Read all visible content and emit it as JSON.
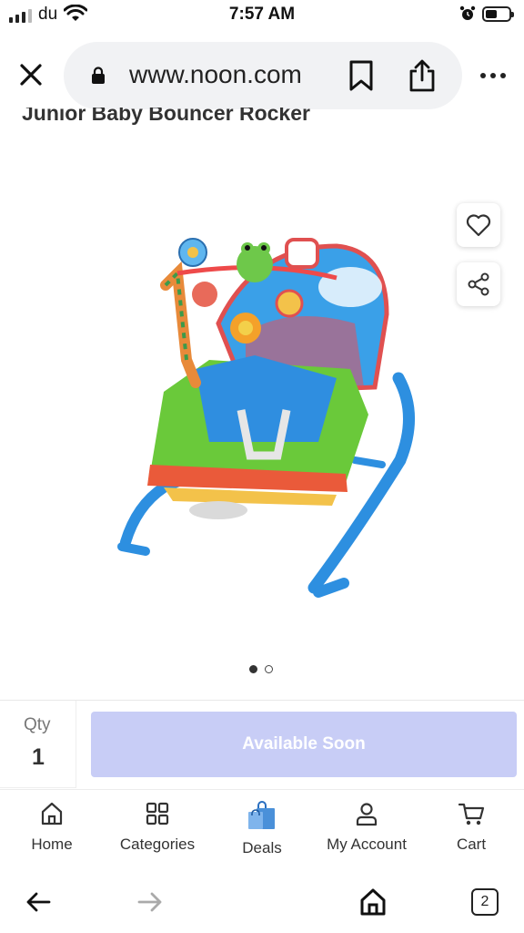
{
  "status_bar": {
    "carrier": "du",
    "time": "7:57 AM",
    "battery_level": 0.5
  },
  "browser": {
    "url": "www.noon.com",
    "icons": [
      "close-icon",
      "lock-icon",
      "bookmark-icon",
      "share-icon",
      "more-icon"
    ]
  },
  "product": {
    "title": "Junior Baby Bouncer Rocker",
    "image_count": 2,
    "active_image": 1,
    "icons": [
      "heart-icon",
      "share-nodes-icon"
    ]
  },
  "purchase": {
    "qty_label": "Qty",
    "qty_value": "1",
    "cta_label": "Available Soon",
    "cta_color": "#c8cdf6"
  },
  "bottom_nav": {
    "items": [
      {
        "label": "Home",
        "icon": "home-icon"
      },
      {
        "label": "Categories",
        "icon": "categories-icon"
      },
      {
        "label": "Deals",
        "icon": "shopping-bag-icon"
      },
      {
        "label": "My Account",
        "icon": "user-icon"
      },
      {
        "label": "Cart",
        "icon": "cart-icon"
      }
    ]
  },
  "browser_toolbar": {
    "tab_count": "2",
    "icons": [
      "back-arrow-icon",
      "forward-arrow-icon",
      "home-icon",
      "tabs-icon"
    ]
  },
  "colors": {
    "cta_disabled": "#c8cdf6",
    "deals_bag": "#4a90d9"
  }
}
